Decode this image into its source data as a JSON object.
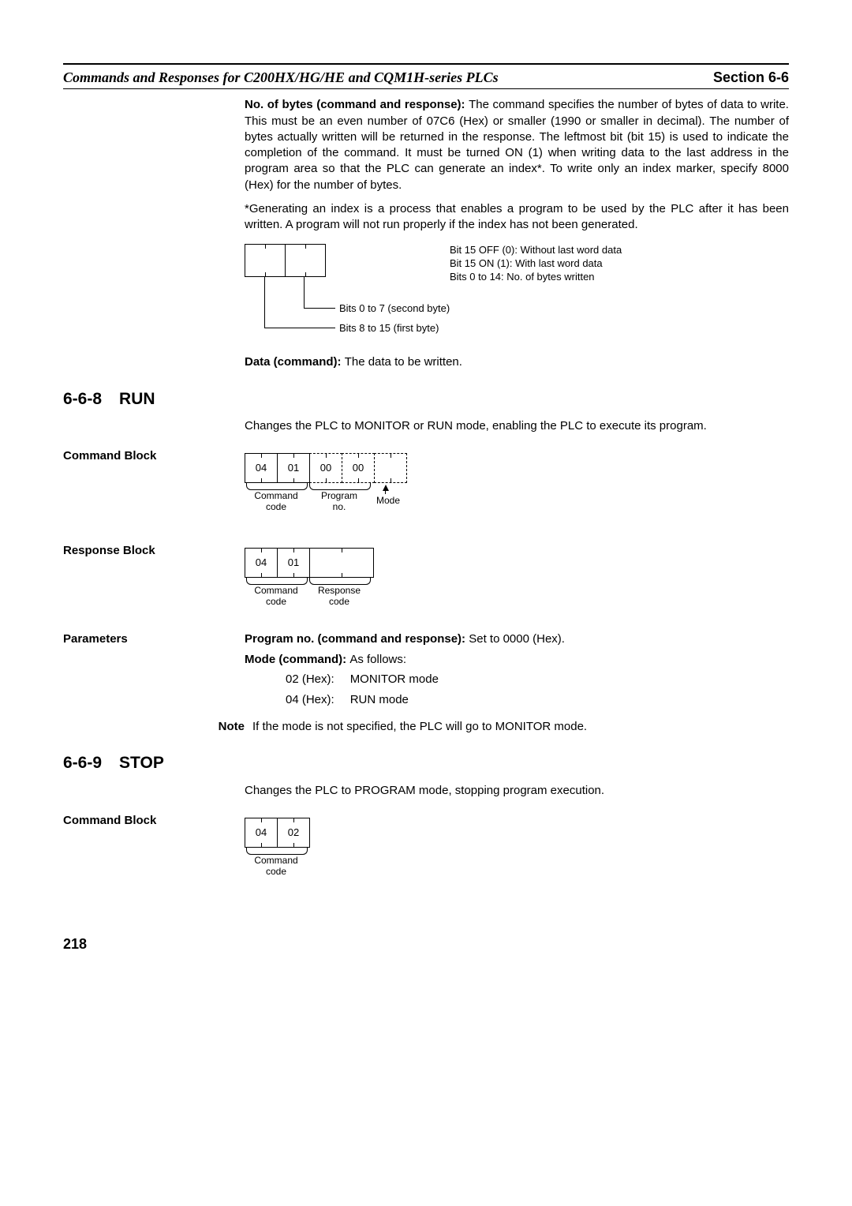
{
  "header": {
    "left": "Commands and Responses for C200HX/HG/HE and CQM1H-series PLCs",
    "right": "Section 6-6"
  },
  "intro": {
    "p1_bold": "No. of bytes (command and response): ",
    "p1": "The command specifies the number of bytes of data to write. This must be an even number of 07C6 (Hex) or smaller (1990 or smaller in decimal). The number of bytes actually written will be returned in the response. The leftmost bit (bit 15) is used to indicate the completion of the command. It must be turned ON (1) when writing data to the last address in the program area so that the PLC can generate an index*. To write only an index marker, specify 8000 (Hex) for the number of bytes.",
    "p2": "*Generating an index is a process that enables a program to be used by the PLC after it has been written. A program will not run properly if the index has not been generated.",
    "diagA": {
      "lab1": "Bits 0 to 7 (second byte)",
      "lab2": "Bits 8 to 15 (first byte)",
      "side1": "Bit 15 OFF (0): Without last word data",
      "side2": "Bit 15 ON (1): With last word data",
      "side3": "Bits 0 to 14: No. of bytes written"
    },
    "p3_bold": "Data (command): ",
    "p3": "The data to be written."
  },
  "sec668": {
    "num": "6-6-8",
    "title": "RUN",
    "desc": "Changes the PLC to MONITOR or RUN mode, enabling the PLC to execute its program.",
    "cmdblock_label": "Command Block",
    "cmdblock": {
      "c1": "04",
      "c2": "01",
      "c3": "00",
      "c4": "00",
      "l1": "Command\ncode",
      "l2": "Program\nno.",
      "l3": "Mode"
    },
    "respblock_label": "Response Block",
    "respblock": {
      "c1": "04",
      "c2": "01",
      "l1": "Command\ncode",
      "l2": "Response\ncode"
    },
    "params_label": "Parameters",
    "params": {
      "line1_bold": "Program no. (command and response): ",
      "line1": "Set to 0000 (Hex).",
      "line2_bold": "Mode (command): ",
      "line2": "As follows:",
      "m1a": "02 (Hex):",
      "m1b": "MONITOR mode",
      "m2a": "04 (Hex):",
      "m2b": "RUN mode"
    },
    "note_label": "Note",
    "note_text": "If the mode is not specified, the PLC will go to MONITOR mode."
  },
  "sec669": {
    "num": "6-6-9",
    "title": "STOP",
    "desc": "Changes the PLC to PROGRAM mode, stopping program execution.",
    "cmdblock_label": "Command Block",
    "cmdblock": {
      "c1": "04",
      "c2": "02",
      "l1": "Command\ncode"
    }
  },
  "page": "218"
}
